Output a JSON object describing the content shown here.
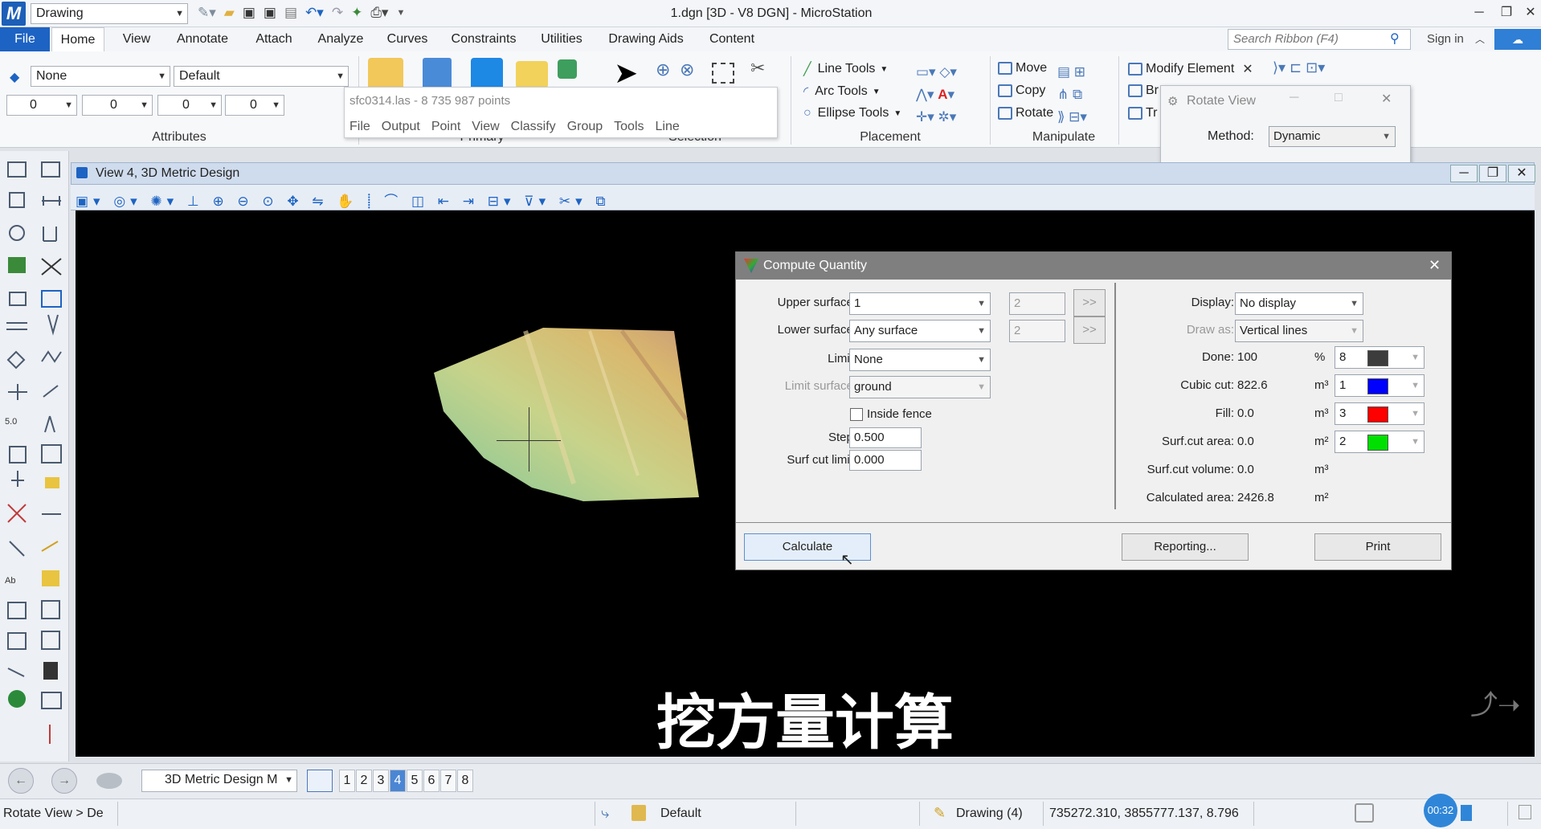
{
  "app": {
    "title": "1.dgn [3D - V8 DGN] - MicroStation",
    "workflow": "Drawing",
    "signin": "Sign in"
  },
  "tabs": [
    "File",
    "Home",
    "View",
    "Annotate",
    "Attach",
    "Analyze",
    "Curves",
    "Constraints",
    "Utilities",
    "Drawing Aids",
    "Content"
  ],
  "search_placeholder": "Search Ribbon (F4)",
  "attributes": {
    "level": "None",
    "style": "Default",
    "color": "0",
    "weight": "0",
    "linestyle": "0",
    "transparency": "0",
    "group_label": "Attributes"
  },
  "ribbon": {
    "primary_label": "Primary",
    "selection_label": "Selection",
    "placement_label": "Placement",
    "manipulate_label": "Manipulate",
    "line_tools": "Line Tools",
    "arc_tools": "Arc Tools",
    "ellipse_tools": "Ellipse Tools",
    "move": "Move",
    "copy": "Copy",
    "rotate": "Rotate",
    "modify_element": "Modify Element",
    "br": "Br",
    "tr": "Tr"
  },
  "sfc_popup": {
    "title": "sfc0314.las - 8 735 987 points",
    "menu": [
      "File",
      "Output",
      "Point",
      "View",
      "Classify",
      "Group",
      "Tools",
      "Line"
    ]
  },
  "rotate_view": {
    "title": "Rotate View",
    "method_label": "Method:",
    "method_value": "Dynamic"
  },
  "view": {
    "title": "View 4, 3D Metric Design"
  },
  "subtitle": "挖方量计算",
  "dialog": {
    "title": "Compute Quantity",
    "upper_surface_label": "Upper surface:",
    "upper_surface_value": "1",
    "upper_surface_extra": "2",
    "lower_surface_label": "Lower surface:",
    "lower_surface_value": "Any surface",
    "lower_surface_extra": "2",
    "limit_label": "Limit:",
    "limit_value": "None",
    "limit_surface_label": "Limit surface:",
    "limit_surface_value": "ground",
    "inside_fence_label": "Inside fence",
    "step_label": "Step:",
    "step_value": "0.500",
    "surf_cut_limit_label": "Surf cut limit:",
    "surf_cut_limit_value": "0.000",
    "display_label": "Display:",
    "display_value": "No display",
    "draw_as_label": "Draw as:",
    "draw_as_value": "Vertical lines",
    "arrow_btn": ">>",
    "results": [
      {
        "label": "Done:",
        "value": "100",
        "unit": "%",
        "color_idx": "8",
        "color": "#3c3c3c"
      },
      {
        "label": "Cubic cut:",
        "value": "822.6",
        "unit": "m³",
        "color_idx": "1",
        "color": "#0000ff"
      },
      {
        "label": "Fill:",
        "value": "0.0",
        "unit": "m³",
        "color_idx": "3",
        "color": "#ff0000"
      },
      {
        "label": "Surf.cut area:",
        "value": "0.0",
        "unit": "m²",
        "color_idx": "2",
        "color": "#00e000"
      },
      {
        "label": "Surf.cut volume:",
        "value": "0.0",
        "unit": "m³"
      },
      {
        "label": "Calculated area:",
        "value": "2426.8",
        "unit": "m²"
      }
    ],
    "calculate_btn": "Calculate",
    "reporting_btn": "Reporting...",
    "print_btn": "Print"
  },
  "navbar": {
    "model": "3D Metric Design M",
    "views": [
      "1",
      "2",
      "3",
      "4",
      "5",
      "6",
      "7",
      "8"
    ],
    "active_view": "4"
  },
  "status": {
    "prompt": "Rotate View > De",
    "level": "Default",
    "model_info": "Drawing (4)",
    "coords": "735272.310, 3855777.137, 8.796",
    "timer": "00:32"
  }
}
